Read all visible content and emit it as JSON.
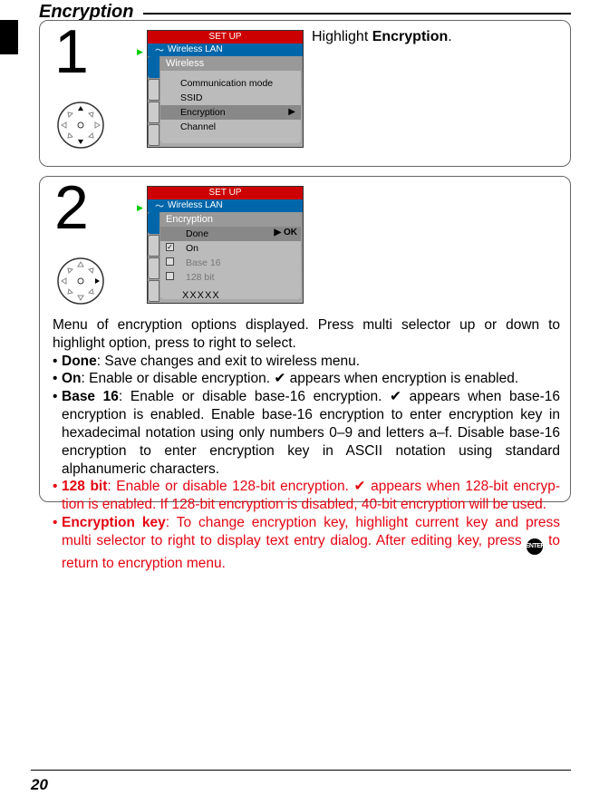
{
  "page": {
    "title": "Encryption",
    "number": "20"
  },
  "step1": {
    "number": "1",
    "instructionPrefix": "Highlight ",
    "instructionBold": "Encryption",
    "instructionSuffix": ".",
    "lcd": {
      "header": "SET  UP",
      "subheader": "Wireless LAN",
      "section": "Wireless",
      "items": {
        "comm": "Communication mode",
        "ssid": "SSID",
        "encryption": "Encryption",
        "channel": "Channel"
      }
    }
  },
  "step2": {
    "number": "2",
    "lcd": {
      "header": "SET  UP",
      "subheader": "Wireless LAN",
      "section": "Encryption",
      "items": {
        "done": "Done",
        "on": "On",
        "base16": "Base 16",
        "bit128": "128 bit",
        "key": "XXXXX"
      },
      "ok": "OK"
    },
    "intro1": "Menu of encryption options displayed.  Press multi selector up or down to highlight option, press to right to select.",
    "bullets": {
      "done": {
        "label": "Done",
        "text": ": Save changes and exit to wireless menu."
      },
      "on": {
        "label": "On",
        "text": ": Enable or disable encryption.  ✔ appears when encryption is enabled."
      },
      "base16": {
        "label": "Base 16",
        "text": ": Enable or disable base-16 encryption.  ✔ appears when base-16 encryp­tion is enabled.  Enable base-16 encryption to enter encryption key in hexadeci­mal notation using only numbers 0–9 and letters a–f.  Disable base-16 encryption to enter encryption key in ASCII notation using standard alphanumeric charac­ters."
      },
      "bit128": {
        "label": "128 bit",
        "text": ": Enable or disable 128-bit encryption.  ✔ appears when 128-bit encryp­tion is enabled.  If 128-bit encryption is disabled, 40-bit encryption will be used."
      },
      "enckey": {
        "label": "Encryption key",
        "textA": ": To change encryption key, highlight current key and press multi selector to right to display text entry dialog.  After editing key, press ",
        "enter": "ENTER",
        "textB": " to return to encryption menu."
      }
    }
  }
}
